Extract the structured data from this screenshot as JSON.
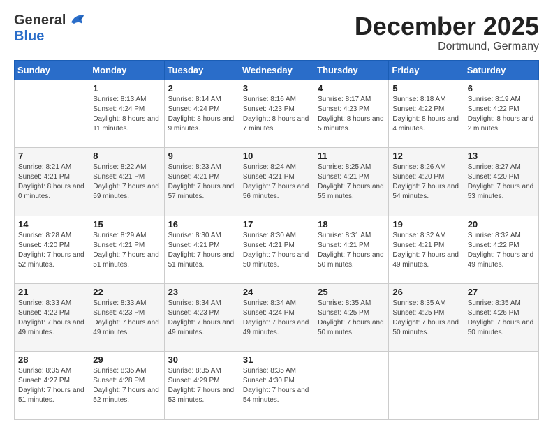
{
  "header": {
    "logo": {
      "line1": "General",
      "line2": "Blue"
    },
    "title": "December 2025",
    "location": "Dortmund, Germany"
  },
  "weekdays": [
    "Sunday",
    "Monday",
    "Tuesday",
    "Wednesday",
    "Thursday",
    "Friday",
    "Saturday"
  ],
  "weeks": [
    [
      {
        "day": "",
        "sunrise": "",
        "sunset": "",
        "daylight": ""
      },
      {
        "day": "1",
        "sunrise": "Sunrise: 8:13 AM",
        "sunset": "Sunset: 4:24 PM",
        "daylight": "Daylight: 8 hours and 11 minutes."
      },
      {
        "day": "2",
        "sunrise": "Sunrise: 8:14 AM",
        "sunset": "Sunset: 4:24 PM",
        "daylight": "Daylight: 8 hours and 9 minutes."
      },
      {
        "day": "3",
        "sunrise": "Sunrise: 8:16 AM",
        "sunset": "Sunset: 4:23 PM",
        "daylight": "Daylight: 8 hours and 7 minutes."
      },
      {
        "day": "4",
        "sunrise": "Sunrise: 8:17 AM",
        "sunset": "Sunset: 4:23 PM",
        "daylight": "Daylight: 8 hours and 5 minutes."
      },
      {
        "day": "5",
        "sunrise": "Sunrise: 8:18 AM",
        "sunset": "Sunset: 4:22 PM",
        "daylight": "Daylight: 8 hours and 4 minutes."
      },
      {
        "day": "6",
        "sunrise": "Sunrise: 8:19 AM",
        "sunset": "Sunset: 4:22 PM",
        "daylight": "Daylight: 8 hours and 2 minutes."
      }
    ],
    [
      {
        "day": "7",
        "sunrise": "Sunrise: 8:21 AM",
        "sunset": "Sunset: 4:21 PM",
        "daylight": "Daylight: 8 hours and 0 minutes."
      },
      {
        "day": "8",
        "sunrise": "Sunrise: 8:22 AM",
        "sunset": "Sunset: 4:21 PM",
        "daylight": "Daylight: 7 hours and 59 minutes."
      },
      {
        "day": "9",
        "sunrise": "Sunrise: 8:23 AM",
        "sunset": "Sunset: 4:21 PM",
        "daylight": "Daylight: 7 hours and 57 minutes."
      },
      {
        "day": "10",
        "sunrise": "Sunrise: 8:24 AM",
        "sunset": "Sunset: 4:21 PM",
        "daylight": "Daylight: 7 hours and 56 minutes."
      },
      {
        "day": "11",
        "sunrise": "Sunrise: 8:25 AM",
        "sunset": "Sunset: 4:21 PM",
        "daylight": "Daylight: 7 hours and 55 minutes."
      },
      {
        "day": "12",
        "sunrise": "Sunrise: 8:26 AM",
        "sunset": "Sunset: 4:20 PM",
        "daylight": "Daylight: 7 hours and 54 minutes."
      },
      {
        "day": "13",
        "sunrise": "Sunrise: 8:27 AM",
        "sunset": "Sunset: 4:20 PM",
        "daylight": "Daylight: 7 hours and 53 minutes."
      }
    ],
    [
      {
        "day": "14",
        "sunrise": "Sunrise: 8:28 AM",
        "sunset": "Sunset: 4:20 PM",
        "daylight": "Daylight: 7 hours and 52 minutes."
      },
      {
        "day": "15",
        "sunrise": "Sunrise: 8:29 AM",
        "sunset": "Sunset: 4:21 PM",
        "daylight": "Daylight: 7 hours and 51 minutes."
      },
      {
        "day": "16",
        "sunrise": "Sunrise: 8:30 AM",
        "sunset": "Sunset: 4:21 PM",
        "daylight": "Daylight: 7 hours and 51 minutes."
      },
      {
        "day": "17",
        "sunrise": "Sunrise: 8:30 AM",
        "sunset": "Sunset: 4:21 PM",
        "daylight": "Daylight: 7 hours and 50 minutes."
      },
      {
        "day": "18",
        "sunrise": "Sunrise: 8:31 AM",
        "sunset": "Sunset: 4:21 PM",
        "daylight": "Daylight: 7 hours and 50 minutes."
      },
      {
        "day": "19",
        "sunrise": "Sunrise: 8:32 AM",
        "sunset": "Sunset: 4:21 PM",
        "daylight": "Daylight: 7 hours and 49 minutes."
      },
      {
        "day": "20",
        "sunrise": "Sunrise: 8:32 AM",
        "sunset": "Sunset: 4:22 PM",
        "daylight": "Daylight: 7 hours and 49 minutes."
      }
    ],
    [
      {
        "day": "21",
        "sunrise": "Sunrise: 8:33 AM",
        "sunset": "Sunset: 4:22 PM",
        "daylight": "Daylight: 7 hours and 49 minutes."
      },
      {
        "day": "22",
        "sunrise": "Sunrise: 8:33 AM",
        "sunset": "Sunset: 4:23 PM",
        "daylight": "Daylight: 7 hours and 49 minutes."
      },
      {
        "day": "23",
        "sunrise": "Sunrise: 8:34 AM",
        "sunset": "Sunset: 4:23 PM",
        "daylight": "Daylight: 7 hours and 49 minutes."
      },
      {
        "day": "24",
        "sunrise": "Sunrise: 8:34 AM",
        "sunset": "Sunset: 4:24 PM",
        "daylight": "Daylight: 7 hours and 49 minutes."
      },
      {
        "day": "25",
        "sunrise": "Sunrise: 8:35 AM",
        "sunset": "Sunset: 4:25 PM",
        "daylight": "Daylight: 7 hours and 50 minutes."
      },
      {
        "day": "26",
        "sunrise": "Sunrise: 8:35 AM",
        "sunset": "Sunset: 4:25 PM",
        "daylight": "Daylight: 7 hours and 50 minutes."
      },
      {
        "day": "27",
        "sunrise": "Sunrise: 8:35 AM",
        "sunset": "Sunset: 4:26 PM",
        "daylight": "Daylight: 7 hours and 50 minutes."
      }
    ],
    [
      {
        "day": "28",
        "sunrise": "Sunrise: 8:35 AM",
        "sunset": "Sunset: 4:27 PM",
        "daylight": "Daylight: 7 hours and 51 minutes."
      },
      {
        "day": "29",
        "sunrise": "Sunrise: 8:35 AM",
        "sunset": "Sunset: 4:28 PM",
        "daylight": "Daylight: 7 hours and 52 minutes."
      },
      {
        "day": "30",
        "sunrise": "Sunrise: 8:35 AM",
        "sunset": "Sunset: 4:29 PM",
        "daylight": "Daylight: 7 hours and 53 minutes."
      },
      {
        "day": "31",
        "sunrise": "Sunrise: 8:35 AM",
        "sunset": "Sunset: 4:30 PM",
        "daylight": "Daylight: 7 hours and 54 minutes."
      },
      {
        "day": "",
        "sunrise": "",
        "sunset": "",
        "daylight": ""
      },
      {
        "day": "",
        "sunrise": "",
        "sunset": "",
        "daylight": ""
      },
      {
        "day": "",
        "sunrise": "",
        "sunset": "",
        "daylight": ""
      }
    ]
  ]
}
